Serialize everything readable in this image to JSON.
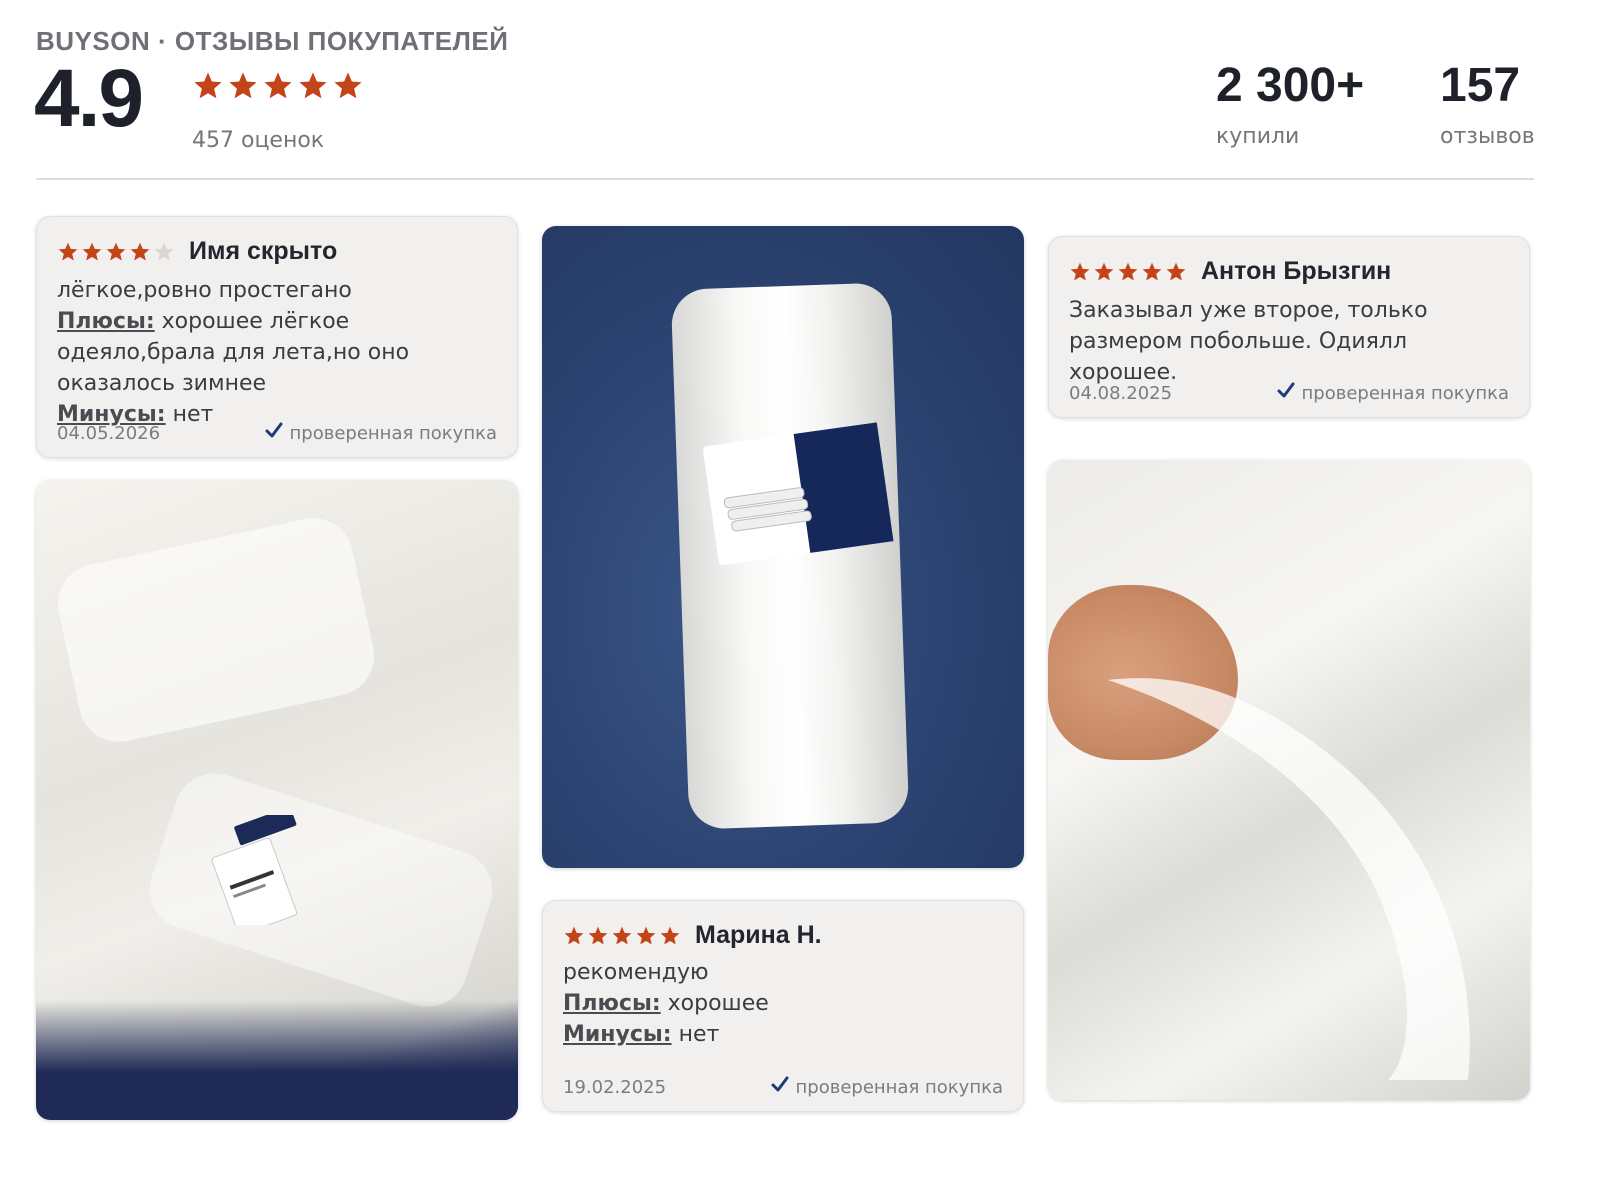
{
  "header": {
    "brand": "BUYSON · ОТЗЫВЫ ПОКУПАТЕЛЕЙ",
    "rating": "4.9",
    "rating_stars": 5,
    "ratings_count": "457 оценок",
    "bought_value": "2 300+",
    "bought_label": "купили",
    "reviews_value": "157",
    "reviews_label": "отзывов"
  },
  "colors": {
    "star": "#c4441a",
    "star_empty": "#d9d8d5",
    "check": "#1f3a7a"
  },
  "reviews": [
    {
      "stars": 4,
      "author": "Имя скрыто",
      "text": "лёгкое,ровно простегано",
      "pros_label": "Плюсы:",
      "pros": "хорошее лёгкое одеяло,брала для лета,но оно оказалось зимнее",
      "cons_label": "Минусы:",
      "cons": "нет",
      "date": "04.05.2026",
      "verified": "проверенная покупка"
    },
    {
      "stars": 5,
      "author": "Антон Брызгин",
      "text": "Заказывал уже второе, только размером побольше. Одиялл хорошее.",
      "date": "04.08.2025",
      "verified": "проверенная покупка"
    },
    {
      "stars": 5,
      "author": "Марина Н.",
      "text": "рекомендую",
      "pros_label": "Плюсы:",
      "pros": "хорошее",
      "cons_label": "Минусы:",
      "cons": "нет",
      "date": "19.02.2025",
      "verified": "проверенная покупка"
    }
  ],
  "photos": {
    "tag_brand": "buyson",
    "tag_product": "BuyBase"
  }
}
